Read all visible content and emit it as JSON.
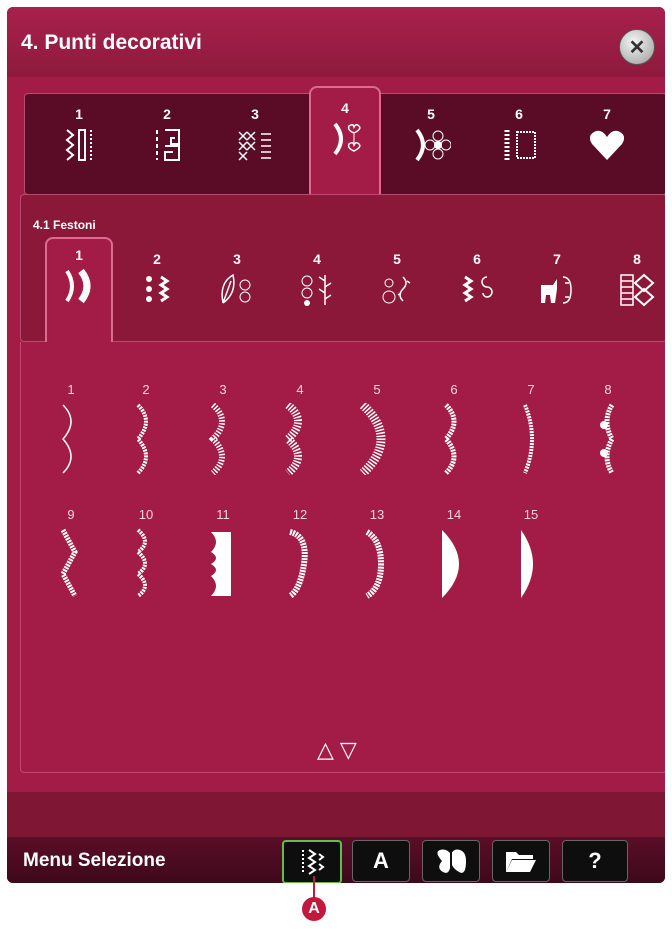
{
  "header": {
    "title": "4. Punti decorativi",
    "close_glyph": "✕"
  },
  "categories": [
    {
      "num": "1",
      "icon": "utility-stitch-icon"
    },
    {
      "num": "2",
      "icon": "greek-key-icon"
    },
    {
      "num": "3",
      "icon": "cross-stitch-icon"
    },
    {
      "num": "4",
      "icon": "scallop-heart-icon",
      "active": true
    },
    {
      "num": "5",
      "icon": "flower-icon"
    },
    {
      "num": "6",
      "icon": "border-frame-icon"
    },
    {
      "num": "7",
      "icon": "heart-icon"
    }
  ],
  "subcategory": {
    "title": "4.1 Festoni",
    "tabs": [
      {
        "num": "1",
        "icon": "scallop-icon",
        "active": true
      },
      {
        "num": "2",
        "icon": "bead-icon"
      },
      {
        "num": "3",
        "icon": "leaf-icon"
      },
      {
        "num": "4",
        "icon": "vine-icon"
      },
      {
        "num": "5",
        "icon": "ornament-icon"
      },
      {
        "num": "6",
        "icon": "swirl-icon"
      },
      {
        "num": "7",
        "icon": "animal-icon"
      },
      {
        "num": "8",
        "icon": "geometric-icon"
      }
    ]
  },
  "stitches": [
    "1",
    "2",
    "3",
    "4",
    "5",
    "6",
    "7",
    "8",
    "9",
    "10",
    "11",
    "12",
    "13",
    "14",
    "15"
  ],
  "scroll": {
    "up": "△",
    "down": "▽"
  },
  "bottom_bar": {
    "label": "Menu Selezione",
    "buttons": [
      {
        "name": "stitches-button",
        "icon": "stitch-icon",
        "selected": true
      },
      {
        "name": "font-button",
        "glyph": "A"
      },
      {
        "name": "embroidery-button",
        "icon": "butterfly-icon"
      },
      {
        "name": "file-button",
        "icon": "folder-icon"
      },
      {
        "name": "help-button",
        "glyph": "?"
      }
    ]
  },
  "callout": "A",
  "colors": {
    "background": "#a31c47",
    "accent": "#d86d91",
    "selected": "#5fbf4a",
    "callout": "#c2183c"
  }
}
